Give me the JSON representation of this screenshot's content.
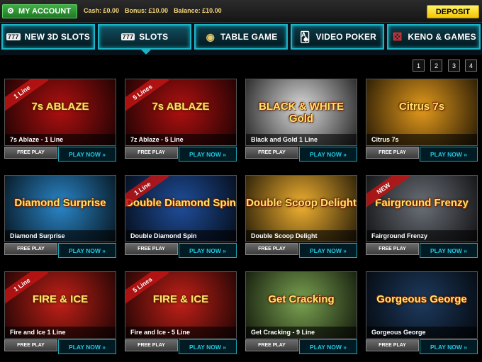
{
  "header": {
    "my_account": "MY ACCOUNT",
    "cash": "Cash: £0.00",
    "bonus": "Bonus: £10.00",
    "balance": "Balance: £10.00",
    "deposit": "DEPOSIT"
  },
  "tabs": [
    {
      "label": "NEW 3D SLOTS",
      "icon": "777"
    },
    {
      "label": "SLOTS",
      "icon": "777"
    },
    {
      "label": "TABLE GAME",
      "icon": "roulette"
    },
    {
      "label": "VIDEO POKER",
      "icon": "cards"
    },
    {
      "label": "KENO & GAMES",
      "icon": "dice"
    }
  ],
  "pages": [
    "1",
    "2",
    "3",
    "4"
  ],
  "buttons": {
    "free": "FREE PLAY",
    "play": "PLAY NOW »"
  },
  "games": [
    {
      "name": "7s Ablaze - 1 Line",
      "ribbon": "1 Line",
      "logo": "7s ABLAZE",
      "bg": "#b01010"
    },
    {
      "name": "7z Ablaze - 5 Line",
      "ribbon": "5 Lines",
      "logo": "7s ABLAZE",
      "bg": "#b01010"
    },
    {
      "name": "Black and Gold 1 Line",
      "ribbon": "",
      "logo": "BLACK & WHITE Gold",
      "bg": "#dcdcdc"
    },
    {
      "name": "Citrus 7s",
      "ribbon": "",
      "logo": "Citrus 7s",
      "bg": "#e49a1c"
    },
    {
      "name": "Diamond Surprise",
      "ribbon": "",
      "logo": "Diamond Surprise",
      "bg": "#2a86c8"
    },
    {
      "name": "Double Diamond Spin",
      "ribbon": "1 Line",
      "logo": "Double Diamond Spin",
      "bg": "#1f4e9b"
    },
    {
      "name": "Double Scoop Delight",
      "ribbon": "",
      "logo": "Double Scoop Delight",
      "bg": "#f0b030"
    },
    {
      "name": "Fairground Frenzy",
      "ribbon": "NEW",
      "logo": "Fairground Frenzy",
      "bg": "#6a6f77"
    },
    {
      "name": "Fire and Ice 1 Line",
      "ribbon": "1 Line",
      "logo": "FIRE & ICE",
      "bg": "#c22018"
    },
    {
      "name": "Fire and Ice - 5 Line",
      "ribbon": "5 Lines",
      "logo": "FIRE & ICE",
      "bg": "#c22018"
    },
    {
      "name": "Get Cracking - 9 Line",
      "ribbon": "",
      "logo": "Get Cracking",
      "bg": "#7aa250"
    },
    {
      "name": "Gorgeous George",
      "ribbon": "",
      "logo": "Gorgeous George",
      "bg": "#1d3a5e"
    }
  ]
}
